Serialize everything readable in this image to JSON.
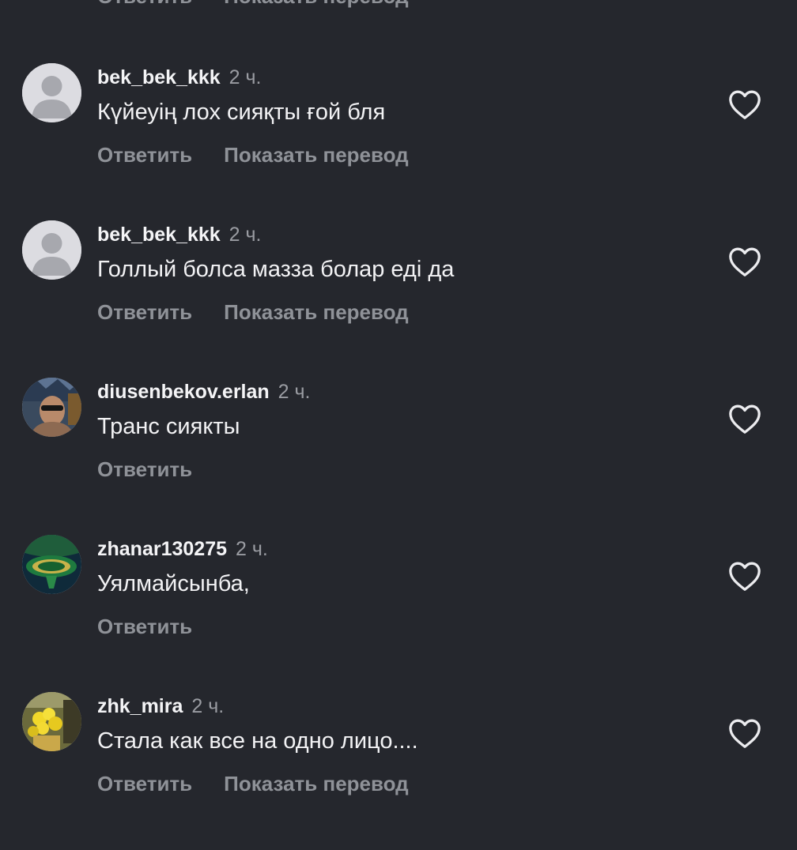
{
  "labels": {
    "reply": "Ответить",
    "translate": "Показать перевод"
  },
  "colors": {
    "background": "#25272d",
    "text": "#f2f2f4",
    "secondary": "#8f9298"
  },
  "comments": [
    {
      "username": "bek_bek_kkk",
      "time": "2 ч.",
      "text": "Күйеуің лох сияқты ғой бля",
      "avatar": "default-avatar"
    },
    {
      "username": "bek_bek_kkk",
      "time": "2 ч.",
      "text": "Голлый болса мазза болар еді да",
      "avatar": "default-avatar"
    },
    {
      "username": "diusenbekov.erlan",
      "time": "2 ч.",
      "text": "Транс сиякты",
      "avatar": "photo-avatar"
    },
    {
      "username": "zhanar130275",
      "time": "2 ч.",
      "text": "Уялмайсынба,",
      "avatar": "photo-avatar"
    },
    {
      "username": "zhk_mira",
      "time": "2 ч.",
      "text": "Стала как все на одно лицо....",
      "avatar": "photo-avatar"
    }
  ]
}
